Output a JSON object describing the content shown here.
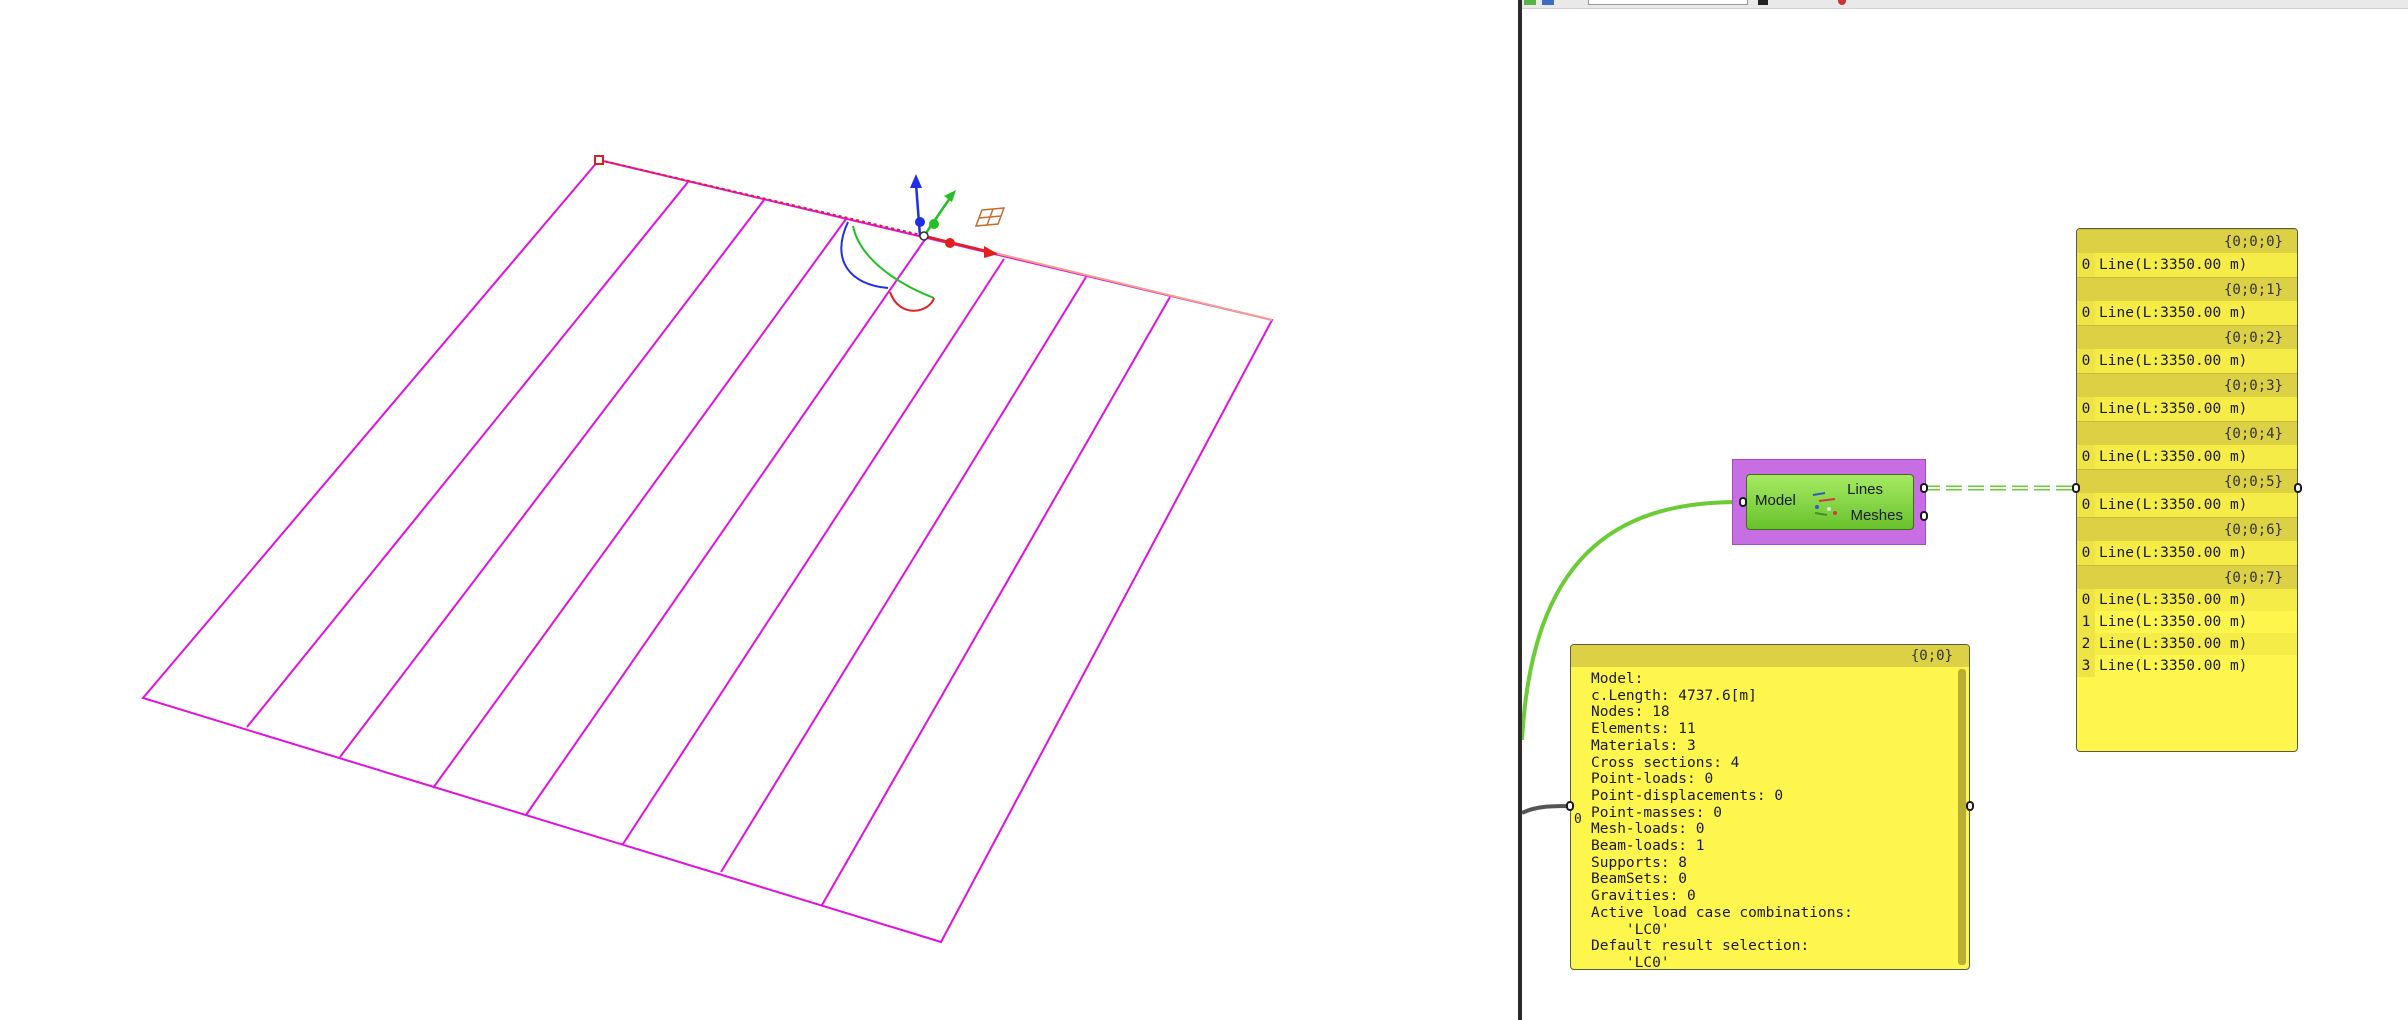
{
  "colors": {
    "geometry": "#e012e0",
    "axis_x": "#e0201f",
    "axis_y": "#22c022",
    "axis_z": "#1f2ee8",
    "wire_selected": "#6ccc36",
    "wire_default": "#555555",
    "panel_bg": "#fff64d",
    "panel_header": "#dcd145",
    "component_green": "#8bd84a",
    "component_selected": "#c86ee3"
  },
  "viewport": {
    "icons": [
      "gumball-x-arrow-icon",
      "gumball-y-arrow-icon",
      "gumball-z-arrow-icon",
      "plane-grid-icon"
    ]
  },
  "component": {
    "input_label": "Model",
    "outputs": [
      "Lines",
      "Meshes"
    ],
    "icon": "deconstruct-model-icon"
  },
  "model_panel": {
    "path": "{0;0}",
    "input_index": "0",
    "lines": [
      "Model:",
      "c.Length: 4737.6[m]",
      "Nodes: 18",
      "Elements: 11",
      "Materials: 3",
      "Cross sections: 4",
      "Point-loads: 0",
      "Point-displacements: 0",
      "Point-masses: 0",
      "Mesh-loads: 0",
      "Beam-loads: 1",
      "Supports: 8",
      "BeamSets: 0",
      "Gravities: 0",
      "Active load case combinations:",
      "    'LC0'",
      "Default result selection:",
      "    'LC0'"
    ]
  },
  "lines_panel": {
    "branches": [
      {
        "path": "{0;0;0}",
        "items": [
          {
            "i": "0",
            "v": "Line(L:3350.00 m)"
          }
        ]
      },
      {
        "path": "{0;0;1}",
        "items": [
          {
            "i": "0",
            "v": "Line(L:3350.00 m)"
          }
        ]
      },
      {
        "path": "{0;0;2}",
        "items": [
          {
            "i": "0",
            "v": "Line(L:3350.00 m)"
          }
        ]
      },
      {
        "path": "{0;0;3}",
        "items": [
          {
            "i": "0",
            "v": "Line(L:3350.00 m)"
          }
        ]
      },
      {
        "path": "{0;0;4}",
        "items": [
          {
            "i": "0",
            "v": "Line(L:3350.00 m)"
          }
        ]
      },
      {
        "path": "{0;0;5}",
        "items": [
          {
            "i": "0",
            "v": "Line(L:3350.00 m)"
          }
        ]
      },
      {
        "path": "{0;0;6}",
        "items": [
          {
            "i": "0",
            "v": "Line(L:3350.00 m)"
          }
        ]
      },
      {
        "path": "{0;0;7}",
        "items": [
          {
            "i": "0",
            "v": "Line(L:3350.00 m)"
          },
          {
            "i": "1",
            "v": "Line(L:3350.00 m)"
          },
          {
            "i": "2",
            "v": "Line(L:3350.00 m)"
          },
          {
            "i": "3",
            "v": "Line(L:3350.00 m)"
          }
        ]
      }
    ]
  }
}
